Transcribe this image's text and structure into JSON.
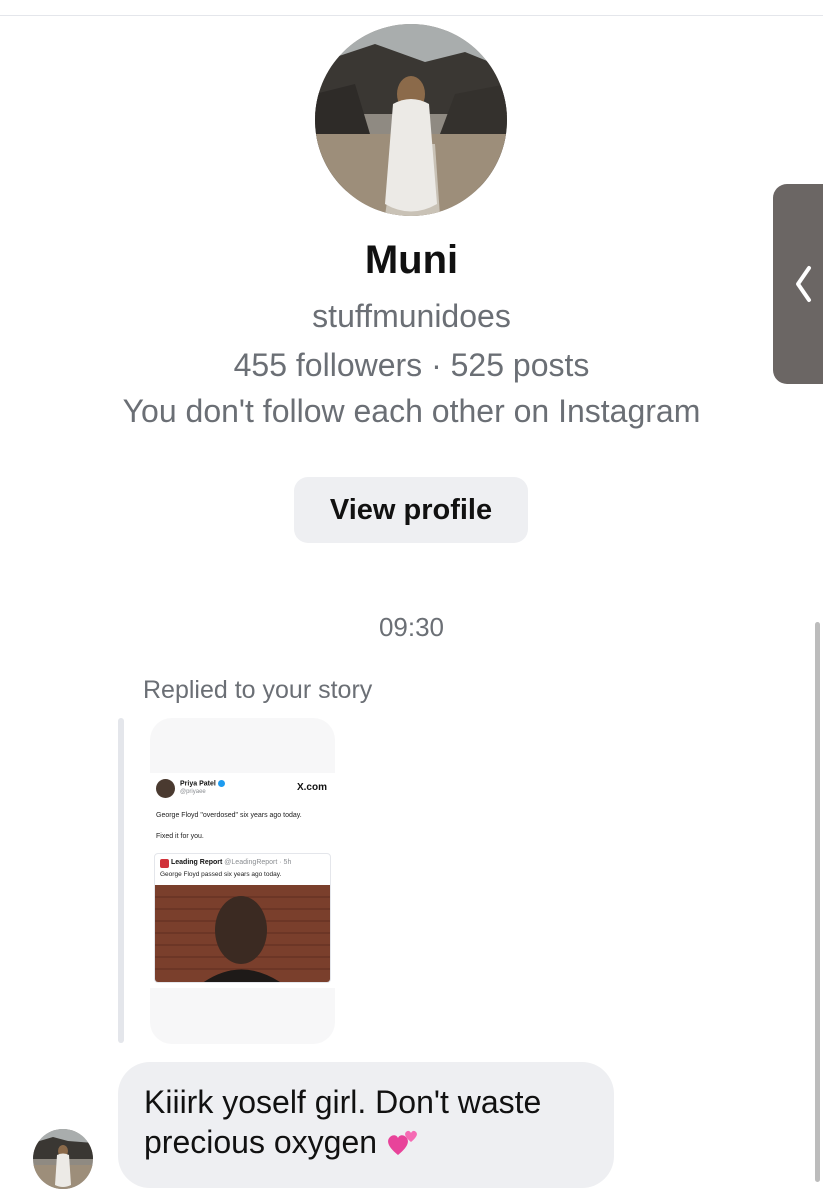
{
  "profile": {
    "name": "Muni",
    "username": "stuffmunidoes",
    "stats": "455 followers · 525 posts",
    "follow_status": "You don't follow each other on Instagram",
    "view_profile_label": "View profile"
  },
  "thread": {
    "timestamp": "09:30",
    "story_reply_label": "Replied to your story"
  },
  "story": {
    "author": "Priya Patel",
    "handle": "@priyaee",
    "source": "X.com",
    "text_line_1": "George Floyd \"overdosed\" six years ago today.",
    "text_line_2": "Fixed it for you.",
    "quote": {
      "author": "Leading Report",
      "handle": "@LeadingReport · 5h",
      "text": "George Floyd passed six years ago today."
    }
  },
  "message": {
    "text": "Kiiirk yoself girl. Don't waste precious oxygen",
    "emoji_icon": "two-hearts-icon"
  },
  "icons": {
    "side_tab": "chevron-left-icon",
    "heart": "two-hearts-icon"
  },
  "colors": {
    "bubble": "#eeeff2",
    "secondary_text": "#6b6f75",
    "side_tab": "#6b6664"
  }
}
